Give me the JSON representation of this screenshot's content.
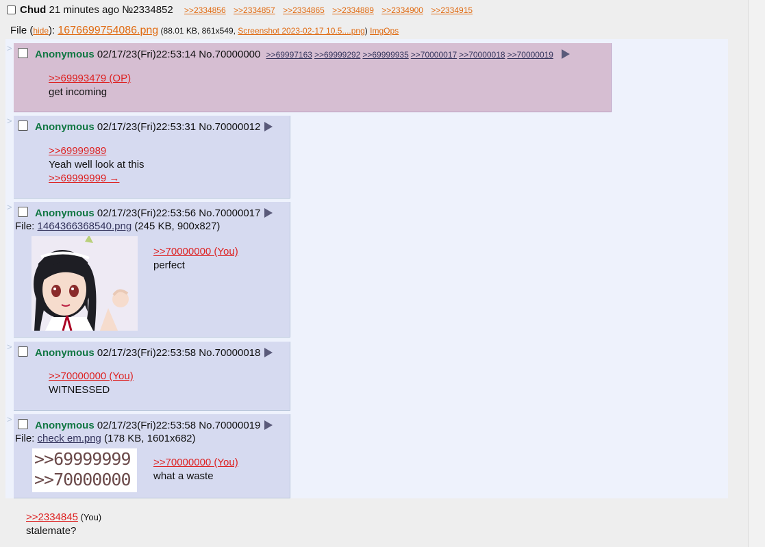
{
  "header": {
    "name": "Chud",
    "time": "21 minutes ago",
    "post_no": "№2334852",
    "backlinks": [
      ">>2334856",
      ">>2334857",
      ">>2334865",
      ">>2334889",
      ">>2334900",
      ">>2334915"
    ]
  },
  "file": {
    "label": "File (",
    "hide": "hide",
    "after_hide": "): ",
    "filename": "1676699754086.png",
    "meta_pre": " (88.01 KB, 861x549, ",
    "orig": "Screenshot 2023-02-17 10.5....png",
    "meta_post": ") ",
    "imgops": "ImgOps"
  },
  "replies": [
    {
      "name": "Anonymous",
      "datetime": "02/17/23(Fri)22:53:14",
      "no": "No.70000000",
      "backlinks": [
        ">>69997163",
        ">>69999292",
        ">>69999935",
        ">>70000017",
        ">>70000018",
        ">>70000019"
      ],
      "quote": ">>69993479 (OP)",
      "text": "get incoming"
    },
    {
      "name": "Anonymous",
      "datetime": "02/17/23(Fri)22:53:31",
      "no": "No.70000012",
      "quote": ">>69999989",
      "text": "Yeah well look at this",
      "quote2": ">>69999999 →"
    },
    {
      "name": "Anonymous",
      "datetime": "02/17/23(Fri)22:53:56",
      "no": "No.70000017",
      "file_label": "File: ",
      "file_name": "1464366368540.png",
      "file_meta": " (245 KB, 900x827)",
      "quote": ">>70000000 (You)",
      "text": "perfect"
    },
    {
      "name": "Anonymous",
      "datetime": "02/17/23(Fri)22:53:58",
      "no": "No.70000018",
      "quote": ">>70000000 (You)",
      "text": "WITNESSED"
    },
    {
      "name": "Anonymous",
      "datetime": "02/17/23(Fri)22:53:58",
      "no": "No.70000019",
      "file_label": "File: ",
      "file_name": "check em.png",
      "file_meta": " (178 KB, 1601x682)",
      "thumb_line1": ">>69999999",
      "thumb_line2": ">>70000000",
      "quote": ">>70000000 (You)",
      "text": "what a waste"
    }
  ],
  "bottom": {
    "quote": ">>2334845",
    "you": " (You)",
    "text": "stalemate?"
  },
  "icons": {
    "checkbox": "checkbox-icon",
    "menu": "triangle-menu-icon",
    "side_arrow": "reply-arrow-icon"
  },
  "colors": {
    "anon_green": "#117743",
    "quote_red": "#dd2222",
    "backlink_orange": "#e06a10",
    "reply_bg": "#d6daf0",
    "highlight_bg": "#d6bed2"
  }
}
